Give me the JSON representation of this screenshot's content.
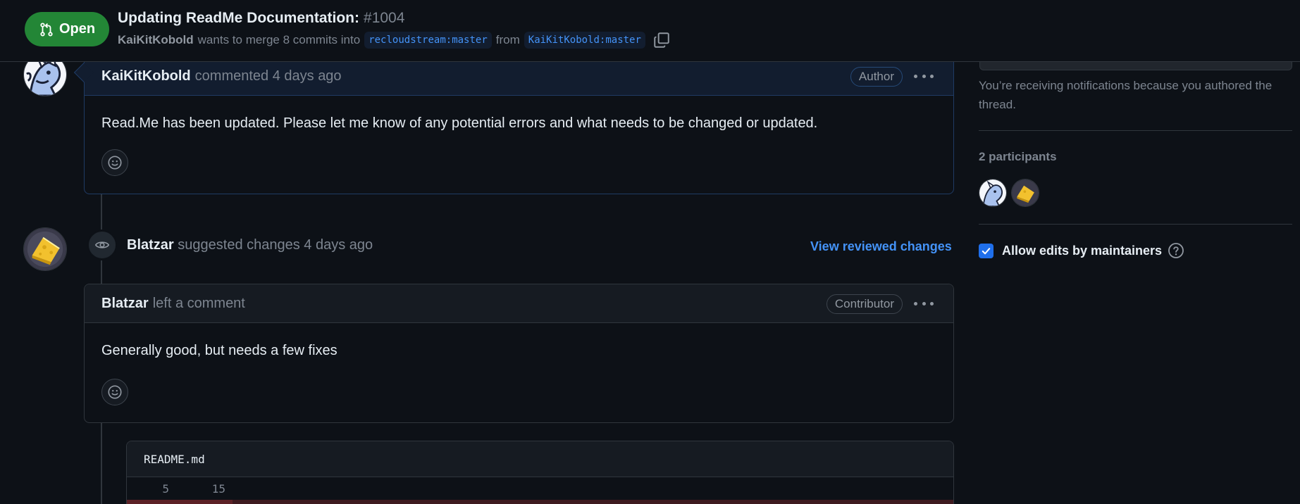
{
  "header": {
    "state": "Open",
    "title": "Updating ReadMe Documentation:",
    "number": "#1004",
    "author": "KaiKitKobold",
    "merge_text": "wants to merge 8 commits into",
    "base_branch": "recloudstream:master",
    "from_text": "from",
    "head_branch": "KaiKitKobold:master",
    "icons": {
      "state": "git-pull-request-icon",
      "copy": "copy-icon"
    }
  },
  "comment1": {
    "author": "KaiKitKobold",
    "action": "commented 4 days ago",
    "role": "Author",
    "body": "Read.Me has been updated. Please let me know of any potential errors and what needs to be changed or updated."
  },
  "review": {
    "author": "Blatzar",
    "action": "suggested changes 4 days ago",
    "view_link": "View reviewed changes",
    "icon": "eye-icon"
  },
  "comment2": {
    "author": "Blatzar",
    "action": "left a comment",
    "role": "Contributor",
    "body": "Generally good, but needs a few fixes"
  },
  "file": {
    "name": "README.md",
    "old_line": "5",
    "new_line": "15"
  },
  "sidebar": {
    "notification_text": "You’re receiving notifications because you authored the thread.",
    "participants_title": "2 participants",
    "allow_edits": "Allow edits by maintainers",
    "allow_edits_checked": true
  },
  "colors": {
    "background": "#0d1117",
    "open_green": "#238636",
    "link_blue": "#4493f8",
    "border": "#30363d"
  }
}
